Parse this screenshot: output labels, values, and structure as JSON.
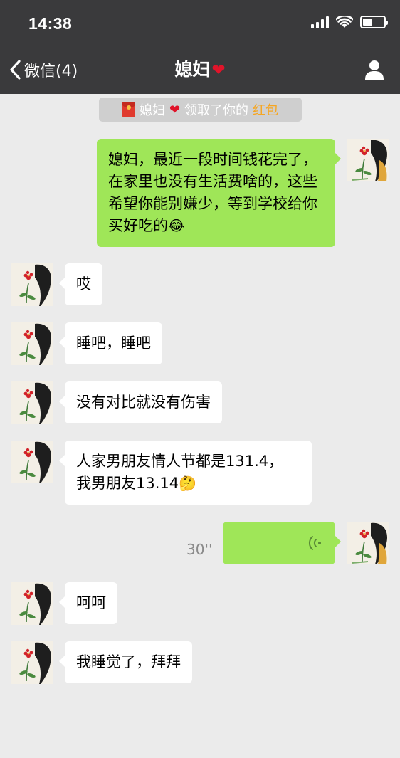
{
  "status_bar": {
    "time": "14:38"
  },
  "nav": {
    "back_label": "微信(4)",
    "title": "媳妇",
    "title_heart": "❤"
  },
  "notice": {
    "prefix": "媳妇",
    "heart": "❤",
    "middle": "领取了你的",
    "link": "红包"
  },
  "messages": [
    {
      "side": "right",
      "text": "媳妇，最近一段时间钱花完了，在家里也没有生活费啥的，这些希望你能别嫌少，等到学校给你买好吃的",
      "emoji": "😂"
    },
    {
      "side": "left",
      "text": "哎"
    },
    {
      "side": "left",
      "text": "睡吧，睡吧"
    },
    {
      "side": "left",
      "text": "没有对比就没有伤害"
    },
    {
      "side": "left",
      "line1": "人家男朋友情人节都是131.4，",
      "line2": "我男朋友13.14",
      "emoji": "🤔"
    },
    {
      "side": "right",
      "type": "voice",
      "duration": "30''"
    },
    {
      "side": "left",
      "text": "呵呵"
    },
    {
      "side": "left",
      "text": "我睡觉了，拜拜"
    }
  ],
  "colors": {
    "nav_bg": "#3a3a3c",
    "chat_bg": "#ebebeb",
    "bubble_self": "#9fe658",
    "bubble_other": "#ffffff",
    "link": "#f5a623",
    "heart": "#e0142a"
  },
  "icons": [
    "back-chevron-icon",
    "profile-icon",
    "signal-icon",
    "wifi-icon",
    "battery-icon",
    "red-packet-icon",
    "voice-wave-icon"
  ]
}
